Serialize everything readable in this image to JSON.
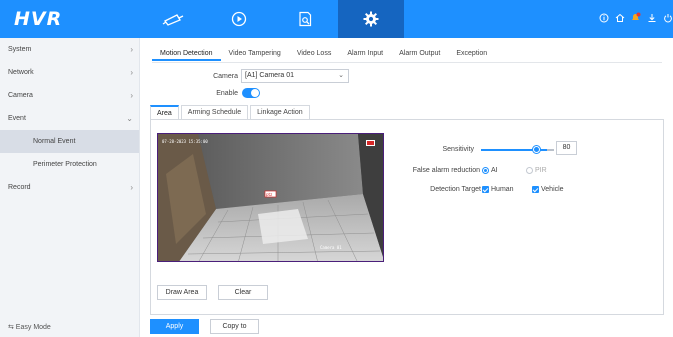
{
  "app": {
    "logo": "HVR"
  },
  "topnav": {
    "items": [
      {
        "icon": "camera-icon",
        "active": false
      },
      {
        "icon": "playback-icon",
        "active": false
      },
      {
        "icon": "file-search-icon",
        "active": false
      },
      {
        "icon": "gear-icon",
        "active": true
      }
    ],
    "right_icons": [
      "info-icon",
      "home-icon",
      "alarm-bell-icon",
      "download-icon",
      "power-icon"
    ]
  },
  "sidebar": {
    "items": [
      {
        "label": "System"
      },
      {
        "label": "Network"
      },
      {
        "label": "Camera"
      },
      {
        "label": "Event"
      },
      {
        "label": "Normal Event"
      },
      {
        "label": "Perimeter Protection"
      },
      {
        "label": "Record"
      }
    ],
    "easy_mode": "⇆ Easy Mode"
  },
  "tabs": [
    "Motion Detection",
    "Video Tampering",
    "Video Loss",
    "Alarm Input",
    "Alarm Output",
    "Exception"
  ],
  "form": {
    "camera_label": "Camera",
    "camera_value": "[A1] Camera 01",
    "enable_label": "Enable",
    "enable_on": true
  },
  "subtabs": [
    "Area",
    "Arming Schedule",
    "Linkage Action"
  ],
  "video": {
    "osd_time": "07-28-2023 15:35:00",
    "osd_name": "Camera 01",
    "rec_badge": "REC"
  },
  "area_buttons": {
    "draw": "Draw Area",
    "clear": "Clear"
  },
  "settings": {
    "sensitivity_label": "Sensitivity",
    "sensitivity_value": "80",
    "false_alarm_label": "False alarm reduction",
    "opt_ai": "AI",
    "opt_pir": "PIR",
    "detection_target_label": "Detection Target",
    "opt_human": "Human",
    "opt_vehicle": "Vehicle"
  },
  "footer": {
    "apply": "Apply",
    "copy_to": "Copy to"
  },
  "colors": {
    "accent": "#1e90ff",
    "topbar": "#1e90ff",
    "sidebar_bg": "#f2f4f7",
    "active_item": "#d8dde6"
  }
}
